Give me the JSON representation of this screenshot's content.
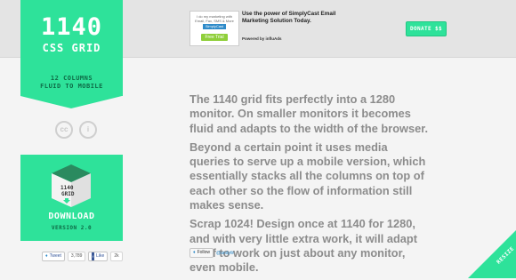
{
  "colors": {
    "accent": "#2ee29a",
    "accent_dark": "#0e6b46",
    "body_text": "#8c8c8c",
    "background": "#f4f4f4",
    "topband": "#e4e4e4"
  },
  "logo": {
    "title": "1140",
    "subtitle": "CSS GRID"
  },
  "tagline": {
    "line1": "12 COLUMNS",
    "line2": "FLUID TO MOBILE"
  },
  "license": {
    "cc_label": "cc",
    "attribution_label": "i"
  },
  "download": {
    "box_line1": "1140",
    "box_line2": "GRID",
    "label": "DOWNLOAD",
    "version": "VERSION 2.0"
  },
  "social": {
    "tweet_label": "Tweet",
    "tweet_count": "3,789",
    "like_label": "Like",
    "like_count": "2k"
  },
  "ad": {
    "image_line1": "I do my marketing with",
    "image_line2": "Email, Fax, SMS & More",
    "image_brand": "SimplyCast",
    "image_button": "Free Trial",
    "headline": "Use the power of SimplyCast Email Marketing Solution Today.",
    "powered_by": "Powered by influAds"
  },
  "donate": {
    "label": "DONATE $$"
  },
  "content": {
    "paragraphs": [
      "The 1140 grid fits perfectly into a 1280 monitor. On smaller monitors it becomes fluid and adapts to the width of the browser.",
      "Beyond a certain point it uses media queries to serve up a mobile version, which essentially stacks all the columns on top of each other so the flow of information still makes sense.",
      "Scrap 1024! Design once at 1140 for 1280, and with very little extra work, it will adapt itself to work on just about any monitor, even mobile."
    ]
  },
  "follow": {
    "button_label": "Follow",
    "handle": "@andytlr"
  },
  "corner": {
    "label": "RESIZE"
  },
  "icons": [
    "cc-icon",
    "attribution-icon",
    "download-box-icon",
    "twitter-bird-icon",
    "facebook-icon"
  ]
}
